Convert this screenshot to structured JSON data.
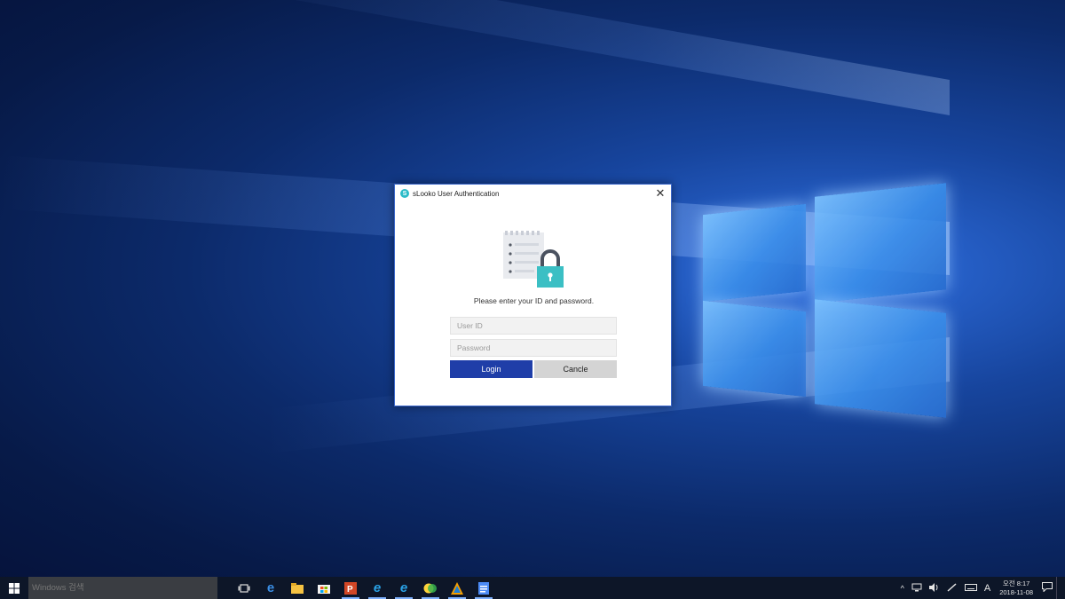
{
  "dialog": {
    "title": "sLooko User Authentication",
    "app_icon_letter": "S",
    "prompt": "Please enter your ID and password.",
    "user_id_placeholder": "User ID",
    "password_placeholder": "Password",
    "login_label": "Login",
    "cancel_label": "Cancle",
    "close_glyph": "✕",
    "accent_color": "#1f3ea8",
    "lock_color": "#3bbfc4"
  },
  "taskbar": {
    "search_placeholder": "Windows 검색",
    "pinned_icons": [
      "task-view-icon",
      "edge-icon",
      "file-explorer-icon",
      "store-icon",
      "powerpoint-icon",
      "internet-explorer-icon",
      "internet-explorer-icon",
      "chat-app-icon",
      "paint-app-icon",
      "document-app-icon"
    ],
    "tray": {
      "ime_label": "A",
      "time": "오전 8:17",
      "date": "2018-11-08"
    }
  }
}
